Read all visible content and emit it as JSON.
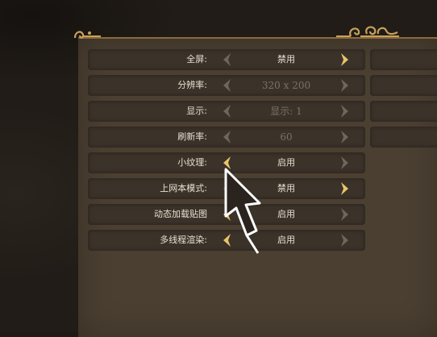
{
  "settings": [
    {
      "label": "全屏:",
      "value": "禁用",
      "value_dim": false,
      "left_active": false,
      "right_active": true
    },
    {
      "label": "分辨率:",
      "value": "320 x 200",
      "value_dim": true,
      "left_active": false,
      "right_active": false
    },
    {
      "label": "显示:",
      "value": "显示: 1",
      "value_dim": true,
      "left_active": false,
      "right_active": false
    },
    {
      "label": "刷新率:",
      "value": "60",
      "value_dim": true,
      "left_active": false,
      "right_active": false
    },
    {
      "label": "小纹理:",
      "value": "启用",
      "value_dim": false,
      "left_active": true,
      "right_active": false
    },
    {
      "label": "上网本模式:",
      "value": "禁用",
      "value_dim": false,
      "left_active": false,
      "right_active": true
    },
    {
      "label": "动态加载贴图",
      "value": "启用",
      "value_dim": false,
      "left_active": true,
      "right_active": false
    },
    {
      "label": "多线程渲染:",
      "value": "启用",
      "value_dim": false,
      "left_active": true,
      "right_active": false
    }
  ],
  "colors": {
    "active_arrow": "#e8c46a",
    "inactive_arrow": "#6f665c",
    "panel": "#4a3f31",
    "row": "#3b3229",
    "text": "#e7dfd1",
    "frame_gold": "#c9a15c"
  },
  "icons": {
    "prev": "chevron-left-icon",
    "next": "chevron-right-icon",
    "pointer": "mouse-pointer-icon"
  }
}
